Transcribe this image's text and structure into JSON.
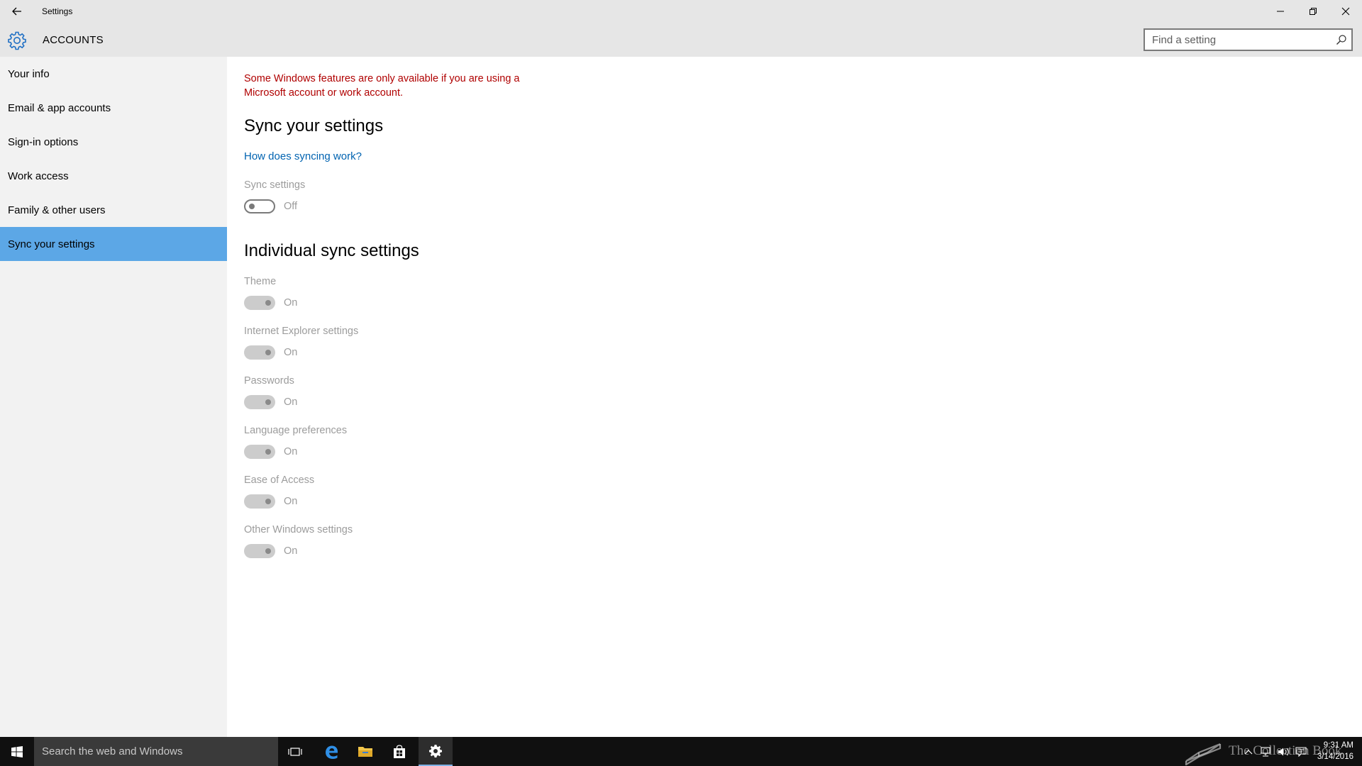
{
  "window": {
    "title": "Settings",
    "section_title": "ACCOUNTS",
    "search_placeholder": "Find a setting"
  },
  "sidebar": {
    "items": [
      {
        "label": "Your info"
      },
      {
        "label": "Email & app accounts"
      },
      {
        "label": "Sign-in options"
      },
      {
        "label": "Work access"
      },
      {
        "label": "Family & other users"
      },
      {
        "label": "Sync your settings",
        "selected": true
      }
    ]
  },
  "main": {
    "warning": "Some Windows features are only available if you are using a Microsoft account or work account.",
    "sync_heading": "Sync your settings",
    "sync_link": "How does syncing work?",
    "sync_setting": {
      "label": "Sync settings",
      "state": "Off"
    },
    "individual_heading": "Individual sync settings",
    "individual_items": [
      {
        "label": "Theme",
        "state": "On"
      },
      {
        "label": "Internet Explorer settings",
        "state": "On"
      },
      {
        "label": "Passwords",
        "state": "On"
      },
      {
        "label": "Language preferences",
        "state": "On"
      },
      {
        "label": "Ease of Access",
        "state": "On"
      },
      {
        "label": "Other Windows settings",
        "state": "On"
      }
    ]
  },
  "taskbar": {
    "search_placeholder": "Search the web and Windows",
    "watermark_text": "The Collection Book",
    "clock": {
      "time": "9:31 AM",
      "date": "3/14/2016"
    }
  },
  "colors": {
    "accent": "#5ca7e6",
    "warning": "#b00000",
    "link": "#0063b1",
    "titlebar": "#e6e6e6",
    "sidebar": "#f2f2f2",
    "taskbar": "#101010"
  }
}
